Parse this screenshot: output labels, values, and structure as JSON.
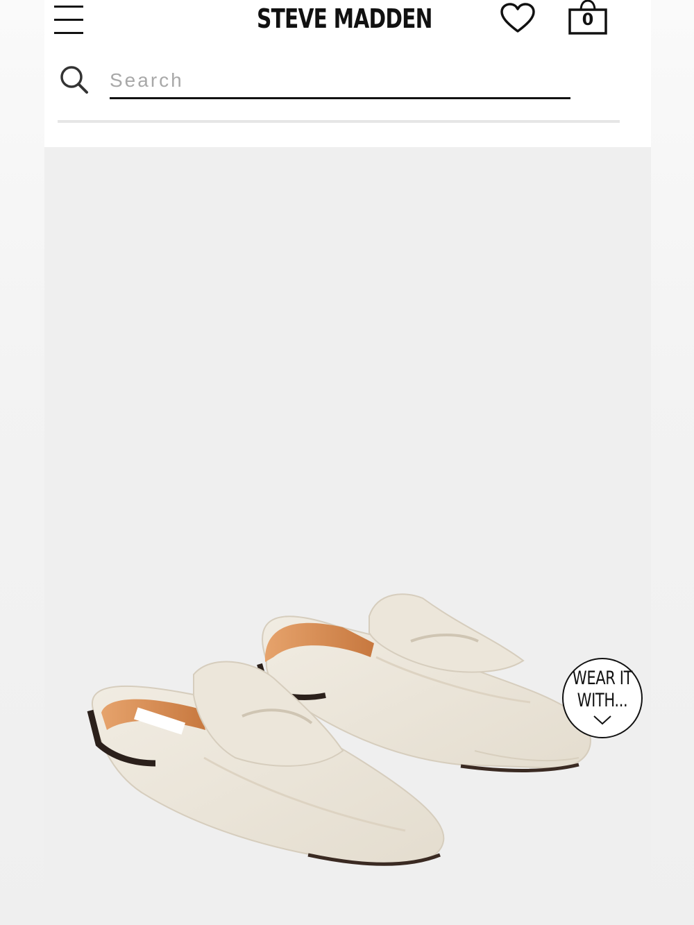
{
  "header": {
    "brand": "STEVE MADDEN",
    "cart_count": "0",
    "menu_icon": "hamburger-menu-icon",
    "wishlist_icon": "heart-icon",
    "cart_icon": "shopping-bag-icon"
  },
  "search": {
    "placeholder": "Search",
    "value": "",
    "icon": "search-icon"
  },
  "product": {
    "image_description": "",
    "badge": {
      "line1": "WEAR IT",
      "line2": "WITH...",
      "icon": "chevron-down-icon"
    }
  },
  "colors": {
    "text": "#111111",
    "image_background": "#efefef",
    "divider": "#e6e6e6",
    "placeholder": "#a8a8a8"
  }
}
